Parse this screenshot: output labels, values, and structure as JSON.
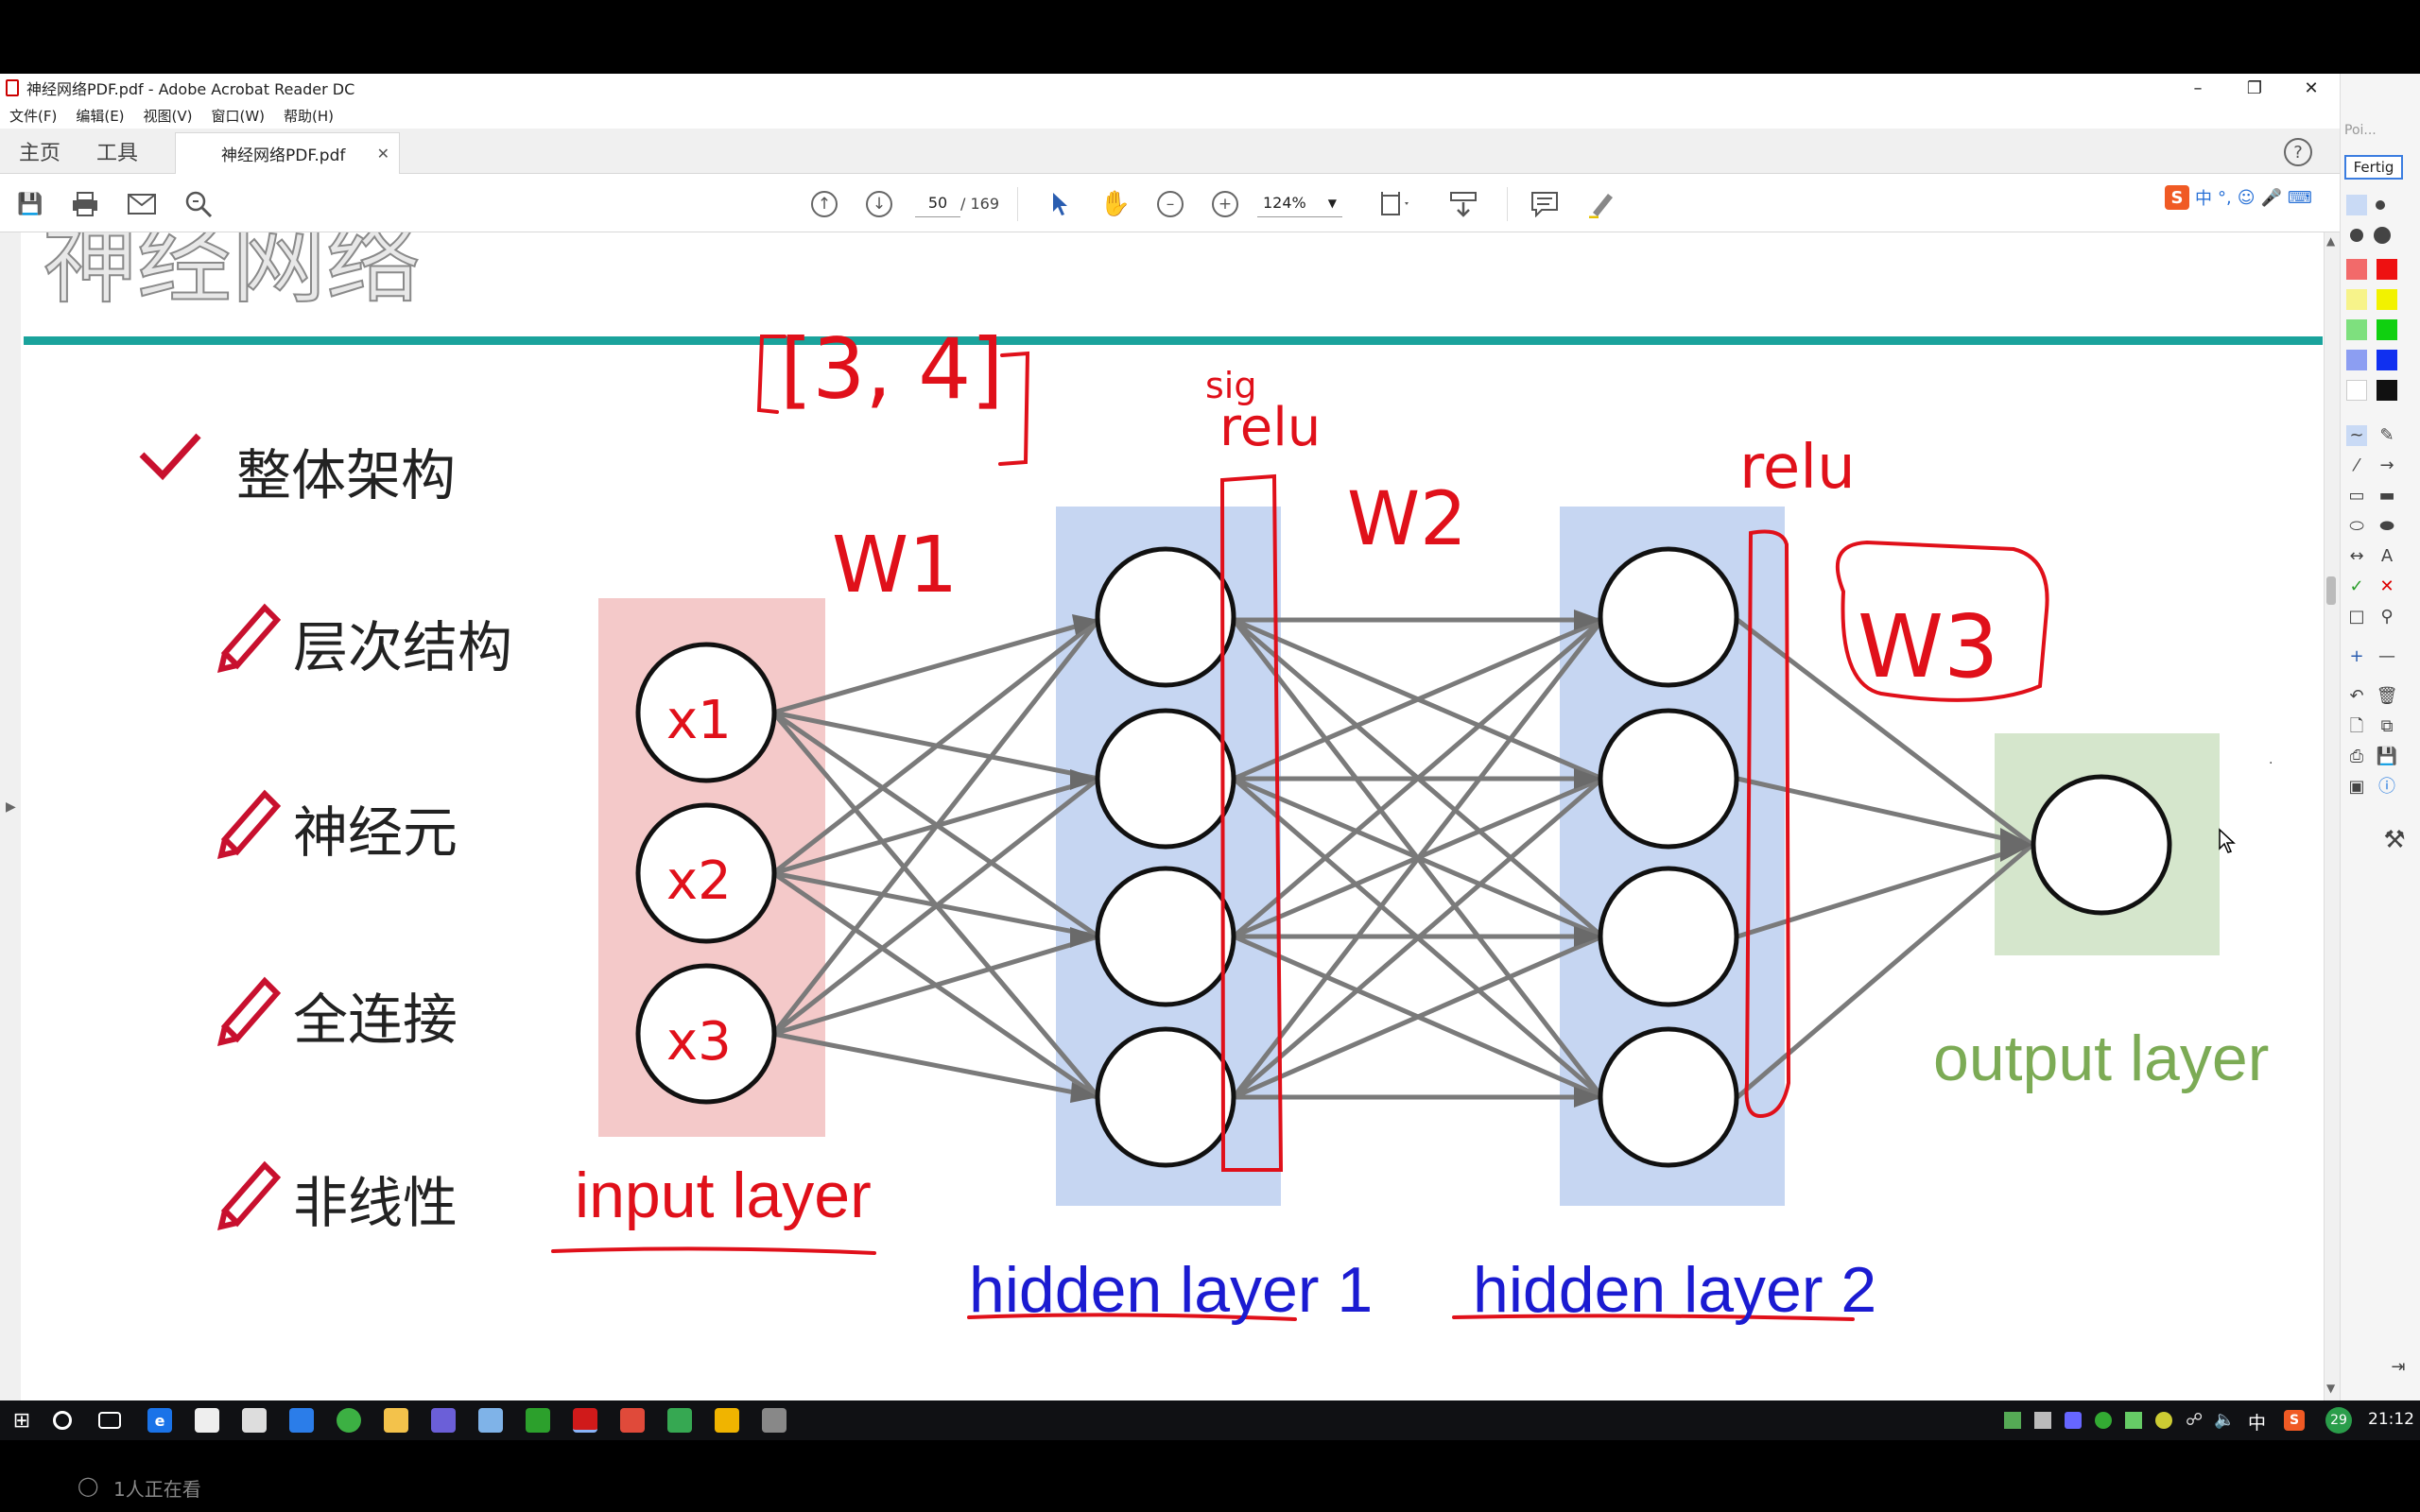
{
  "window": {
    "title": "神经网络PDF.pdf - Adobe Acrobat Reader DC",
    "min_icon": "minimize-icon",
    "restore_icon": "restore-icon",
    "close_icon": "close-icon"
  },
  "menu": [
    "文件(F)",
    "编辑(E)",
    "视图(V)",
    "窗口(W)",
    "帮助(H)"
  ],
  "tabs": {
    "home": "主页",
    "tools": "工具",
    "document": "神经网络PDF.pdf",
    "help_icon": "?"
  },
  "toolbar": {
    "page_current": "50",
    "page_total": "/ 169",
    "zoom": "124%"
  },
  "slide": {
    "title_partial": "神经网络",
    "bullets": [
      "整体架构",
      "层次结构",
      "神经元",
      "全连接",
      "非线性"
    ],
    "input_label": "input layer",
    "hidden1_label": "hidden layer 1",
    "hidden2_label": "hidden layer 2",
    "output_label": "output layer",
    "annotations": {
      "shape": "[3, 4]",
      "w1": "W1",
      "w2": "W2",
      "w3": "W3",
      "relu1": "relu",
      "relu2": "relu",
      "sig": "sig",
      "x1": "x1",
      "x2": "x2",
      "x3": "x3"
    }
  },
  "sidepanel": {
    "top_label": "Poi...",
    "fertig": "Fertig"
  },
  "taskbar": {
    "time": "21:12",
    "ime": "中",
    "badge": "29"
  },
  "bottom": {
    "viewers": "1人正在看"
  },
  "colors": {
    "teal_rule": "#1aa39c",
    "input_bg": "#f4c9c9",
    "hidden_bg": "#c6d6f2",
    "output_bg": "#d5e6cc",
    "ink_red": "#e0101a",
    "hidden_label": "#1b1bd1",
    "input_label": "#e0101a",
    "output_label": "#7cab55"
  }
}
